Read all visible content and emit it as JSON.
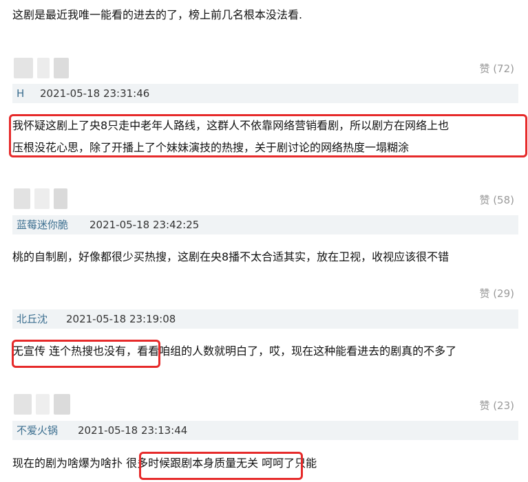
{
  "intro_text": "这剧是最近我唯一能看的进去的了，榜上前几名根本没法看.",
  "comments": [
    {
      "like_label": "赞 (72)",
      "user": "H",
      "time": "2021-05-18 23:31:46",
      "text_lines": [
        "我怀疑这剧上了央8只走中老年人路线，这群人不依靠网络营销看剧，所以剧方在网络上也",
        "压根没花心思，除了开播上了个妹妹演技的热搜，关于剧讨论的网络热度一塌糊涂"
      ]
    },
    {
      "like_label": "赞 (58)",
      "user": "蓝莓迷你脆",
      "time": "2021-05-18 23:42:25",
      "text_lines": [
        "桃的自制剧，好像都很少买热搜，这剧在央8播不太合适其实，放在卫视，收视应该很不错"
      ]
    },
    {
      "like_label": "赞 (29)",
      "user": "北丘沈",
      "time": "2021-05-18 23:19:08",
      "text_lines": [
        "无宣传 连个热搜也没有，看看咱组的人数就明白了，哎，现在这种能看进去的剧真的不多了"
      ]
    },
    {
      "like_label": "赞 (23)",
      "user": "不爱火锅",
      "time": "2021-05-18 23:13:44",
      "text_lines": [
        "现在的剧为啥爆为啥扑 很多时候跟剧本身质量无关 呵呵了只能"
      ]
    }
  ],
  "colors": {
    "highlight_box": "#e62a2a",
    "username": "#3b6e8f",
    "meta_bar": "#f0f3f5"
  }
}
